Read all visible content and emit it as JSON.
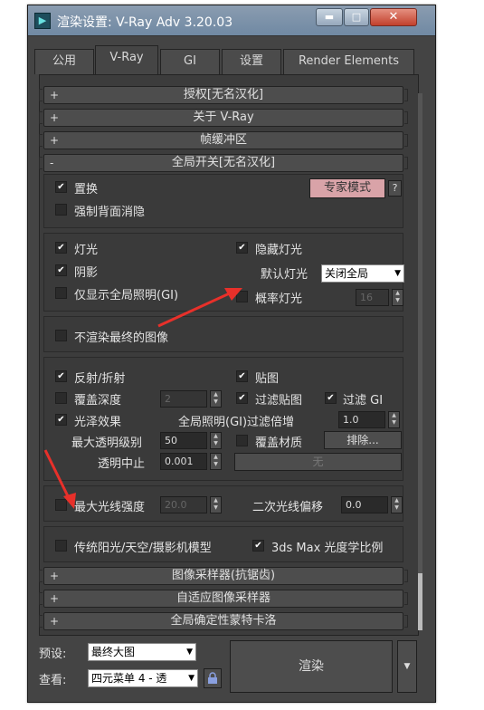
{
  "window": {
    "title": "渲染设置: V-Ray Adv 3.20.03",
    "app_icon": "3ds-max-icon",
    "min": "▬",
    "max": "□",
    "close": "✕"
  },
  "tabs": [
    {
      "label": "公用"
    },
    {
      "label": "V-Ray"
    },
    {
      "label": "GI"
    },
    {
      "label": "设置"
    },
    {
      "label": "Render Elements"
    }
  ],
  "rollouts_top": [
    {
      "pm": "+",
      "label": "授权[无名汉化]"
    },
    {
      "pm": "+",
      "label": "关于 V-Ray"
    },
    {
      "pm": "+",
      "label": "帧缓冲区"
    },
    {
      "pm": "-",
      "label": "全局开关[无名汉化]"
    }
  ],
  "g1": {
    "displacement": "置换",
    "force_back": "强制背面消隐",
    "expert": "专家模式",
    "help": "?"
  },
  "g2": {
    "lights": "灯光",
    "shadows": "阴影",
    "show_gi_only": "仅显示全局照明(GI)",
    "hidden_lights": "隐藏灯光",
    "default_lights_label": "默认灯光",
    "default_lights_value": "关闭全局",
    "prob_lights": "概率灯光",
    "prob_value": "16"
  },
  "g3": {
    "dont_render_final": "不渲染最终的图像"
  },
  "g4": {
    "reflect": "反射/折射",
    "override_depth": "覆盖深度",
    "depth_value": "2",
    "glossy": "光泽效果",
    "max_transp": "最大透明级别",
    "max_transp_value": "50",
    "transp_cutoff": "透明中止",
    "cutoff_value": "0.001",
    "maps": "贴图",
    "filter_maps": "过滤贴图",
    "filter_gi": "过滤 GI",
    "gi_filter_mult": "全局照明(GI)过滤倍增",
    "gi_filter_value": "1.0",
    "override_mtl": "覆盖材质",
    "exclude": "排除...",
    "none": "无"
  },
  "g5": {
    "max_ray": "最大光线强度",
    "max_ray_value": "20.0",
    "sec_bias": "二次光线偏移",
    "sec_bias_value": "0.0"
  },
  "g6": {
    "legacy_sun": "传统阳光/天空/摄影机模型",
    "photometric": "3ds Max 光度学比例"
  },
  "rollouts_bottom": [
    {
      "pm": "+",
      "label": "图像采样器(抗锯齿)"
    },
    {
      "pm": "+",
      "label": "自适应图像采样器"
    },
    {
      "pm": "+",
      "label": "全局确定性蒙特卡洛"
    }
  ],
  "footer": {
    "preset_label": "预设:",
    "preset_value": "最终大图",
    "view_label": "查看:",
    "view_value": "四元菜单 4 - 透",
    "render": "渲染",
    "lock_icon": "lock-icon"
  }
}
